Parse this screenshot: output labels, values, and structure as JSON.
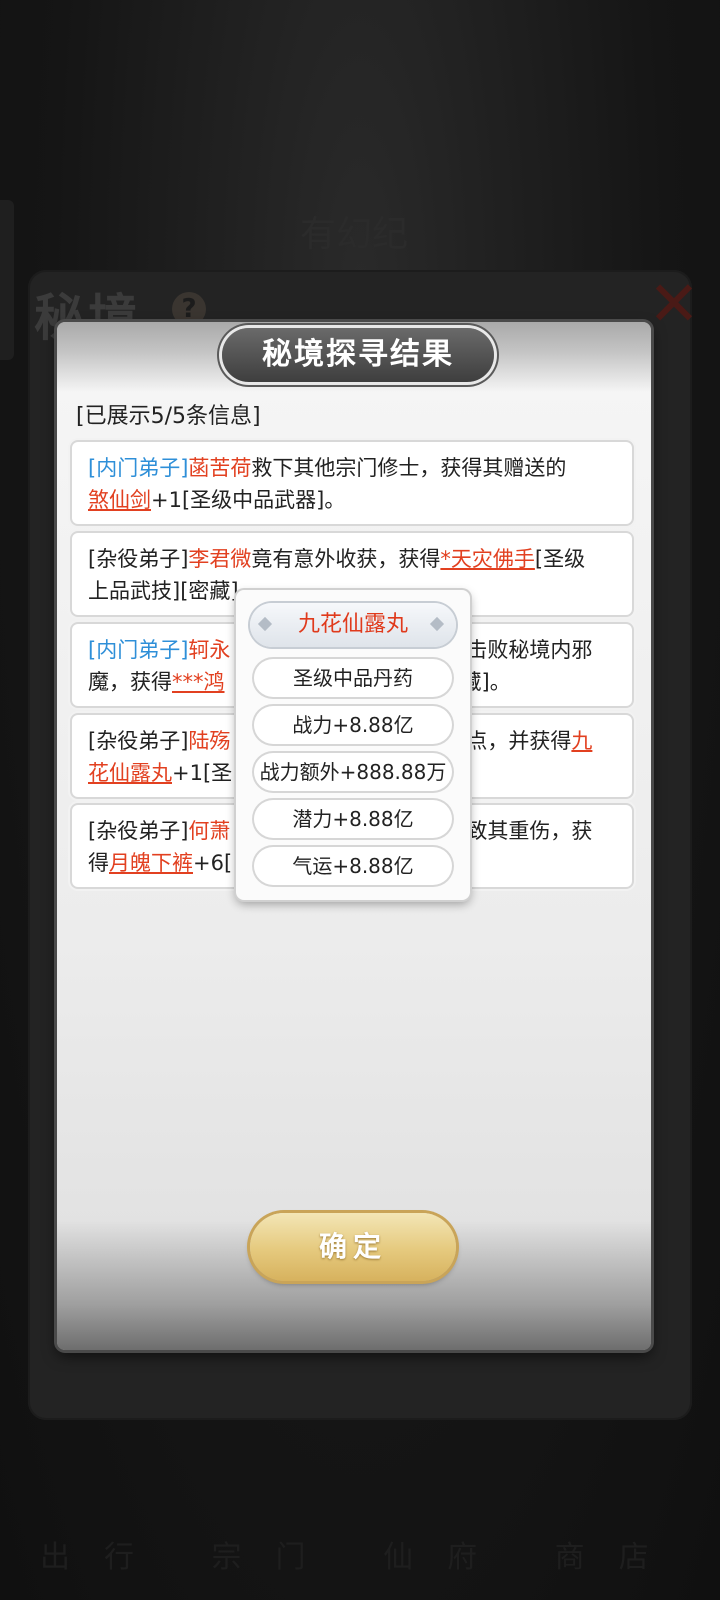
{
  "background": {
    "top_text": "有幻纪",
    "title": "秘境",
    "help_glyph": "?",
    "close_glyph": "✕",
    "bottom_text": "出行 宗门 仙府 商店 天机 家族"
  },
  "panel": {
    "title": "秘境探寻结果",
    "count_label": "[已展示5/5条信息]",
    "confirm_label": "确定"
  },
  "messages": [
    {
      "line1": {
        "rank": "[内门弟子]",
        "name": "菡苦荷",
        "text": "救下其他宗门修士，获得其赠送的"
      },
      "line2": {
        "item": "煞仙剑",
        "text": "+1[圣级中品武器]。"
      }
    },
    {
      "line1": {
        "rank": "[杂役弟子]",
        "name": "李君微",
        "text": "竟有意外收获，获得",
        "item": "*天灾佛手",
        "tail": "[圣级"
      },
      "line2": {
        "text": "上品武技][密藏]。"
      }
    },
    {
      "line1": {
        "rank": "[内门弟子]",
        "name": "轲永",
        "tail": "击败秘境内邪"
      },
      "line2": {
        "text": "魔，获得",
        "item": "***鸿",
        "tail": "藏]。"
      }
    },
    {
      "line1": {
        "rank": "[杂役弟子]",
        "name": "陆殇",
        "tail": "点，并获得",
        "item": "九"
      },
      "line2": {
        "item": "花仙露丸",
        "text": "+1[圣"
      }
    },
    {
      "line1": {
        "rank": "[杂役弟子]",
        "name": "何萧",
        "tail": "致其重伤，获"
      },
      "line2": {
        "pre": "得",
        "item": "月魄下裤",
        "text": "+6["
      }
    }
  ],
  "popup": {
    "title": "九花仙露丸",
    "rows": [
      "圣级中品丹药",
      "战力+8.88亿",
      "战力额外+888.88万",
      "潜力+8.88亿",
      "气运+8.88亿"
    ]
  }
}
